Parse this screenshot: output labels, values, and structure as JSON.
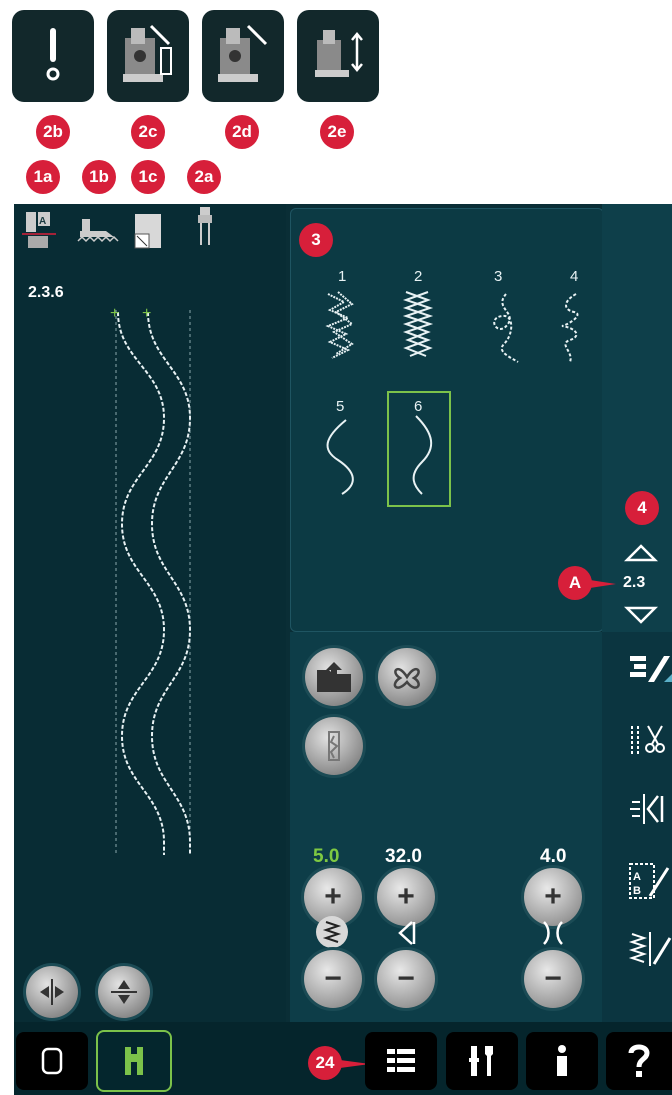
{
  "callouts": {
    "c2b": "2b",
    "c2c": "2c",
    "c2d": "2d",
    "c2e": "2e",
    "c1a": "1a",
    "c1b": "1b",
    "c1c": "1c",
    "c2a": "2a",
    "c3": "3",
    "c4": "4",
    "cA": "A",
    "c24": "24"
  },
  "stitch_id": "2.3.6",
  "stitches": {
    "s1": "1",
    "s2": "2",
    "s3": "3",
    "s4": "4",
    "s5": "5",
    "s6": "6"
  },
  "page_indicator": "2.3",
  "values": {
    "stitch_width": "5.0",
    "stitch_length": "32.0",
    "tension": "4.0"
  },
  "colors": {
    "callout": "#d71f3a",
    "selected_stitch": "#7cc24a",
    "highlight_value": "#7ec942"
  }
}
